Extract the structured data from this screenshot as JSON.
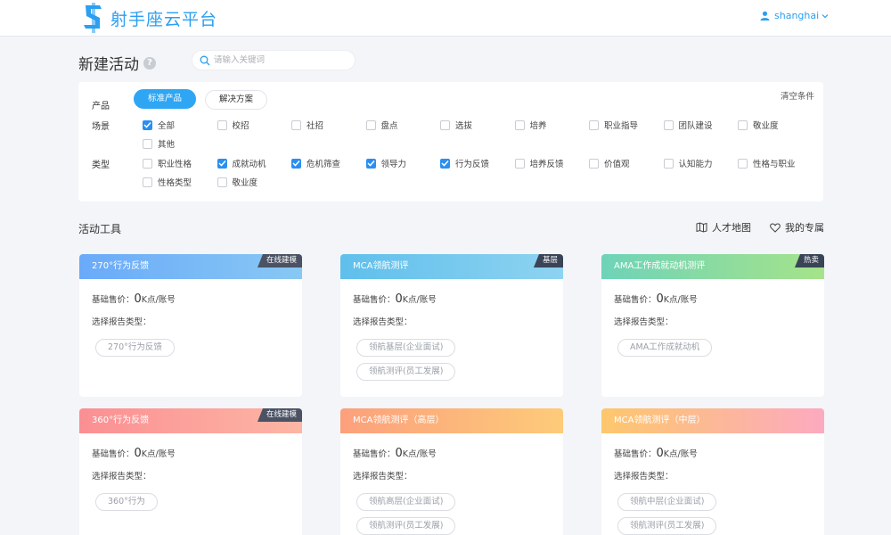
{
  "header": {
    "logo_text": "射手座云平台",
    "username": "shanghai"
  },
  "page": {
    "title": "新建活动",
    "help_mark": "?",
    "search_placeholder": "请输入关键词"
  },
  "filters": {
    "clear_label": "清空条件",
    "product_label": "产品",
    "product_pills": [
      "标准产品",
      "解决方案"
    ],
    "scene_label": "场景",
    "scene_options": [
      {
        "label": "全部",
        "checked": true
      },
      {
        "label": "校招",
        "checked": false
      },
      {
        "label": "社招",
        "checked": false
      },
      {
        "label": "盘点",
        "checked": false
      },
      {
        "label": "选拔",
        "checked": false
      },
      {
        "label": "培养",
        "checked": false
      },
      {
        "label": "职业指导",
        "checked": false
      },
      {
        "label": "团队建设",
        "checked": false
      },
      {
        "label": "敬业度",
        "checked": false
      },
      {
        "label": "其他",
        "checked": false
      }
    ],
    "type_label": "类型",
    "type_options": [
      {
        "label": "职业性格",
        "checked": false
      },
      {
        "label": "成就动机",
        "checked": true
      },
      {
        "label": "危机筛查",
        "checked": true
      },
      {
        "label": "领导力",
        "checked": true
      },
      {
        "label": "行为反馈",
        "checked": true
      },
      {
        "label": "培养反馈",
        "checked": false
      },
      {
        "label": "价值观",
        "checked": false
      },
      {
        "label": "认知能力",
        "checked": false
      },
      {
        "label": "性格与职业",
        "checked": false
      },
      {
        "label": "性格类型",
        "checked": false
      },
      {
        "label": "敬业度",
        "checked": false
      }
    ]
  },
  "section": {
    "title": "活动工具",
    "talent_map_label": "人才地图",
    "favorites_label": "我的专属"
  },
  "card_labels": {
    "price_prefix": "基础售价：",
    "price_suffix": "K点/账号",
    "report_type": "选择报告类型："
  },
  "cards": [
    {
      "title": "270°行为反馈",
      "badge": "在线建模",
      "price": "0",
      "tags": [
        "270°行为反馈"
      ],
      "color_from": "#6aaaf9",
      "color_to": "#88c8f4"
    },
    {
      "title": "MCA领航测评",
      "badge": "基层",
      "price": "0",
      "tags": [
        "领航基层(企业面试)",
        "领航测评(员工发展)"
      ],
      "color_from": "#5fbfec",
      "color_to": "#8ed3f0"
    },
    {
      "title": "AMA工作成就动机测评",
      "badge": "热卖",
      "price": "0",
      "tags": [
        "AMA工作成就动机"
      ],
      "color_from": "#6ed3b8",
      "color_to": "#a6e38a"
    },
    {
      "title": "360°行为反馈",
      "badge": "在线建模",
      "price": "0",
      "tags": [
        "360°行为"
      ],
      "color_from": "#fb8f93",
      "color_to": "#fdb6a4"
    },
    {
      "title": "MCA领航测评（高层）",
      "badge": "",
      "price": "0",
      "tags": [
        "领航高层(企业面试)",
        "领航测评(员工发展)"
      ],
      "color_from": "#fca07c",
      "color_to": "#fdcb7a"
    },
    {
      "title": "MCA领航测评（中层）",
      "badge": "",
      "price": "0",
      "tags": [
        "领航中层(企业面试)",
        "领航测评(员工发展)"
      ],
      "color_from": "#fdc76d",
      "color_to": "#fcaac0"
    }
  ]
}
